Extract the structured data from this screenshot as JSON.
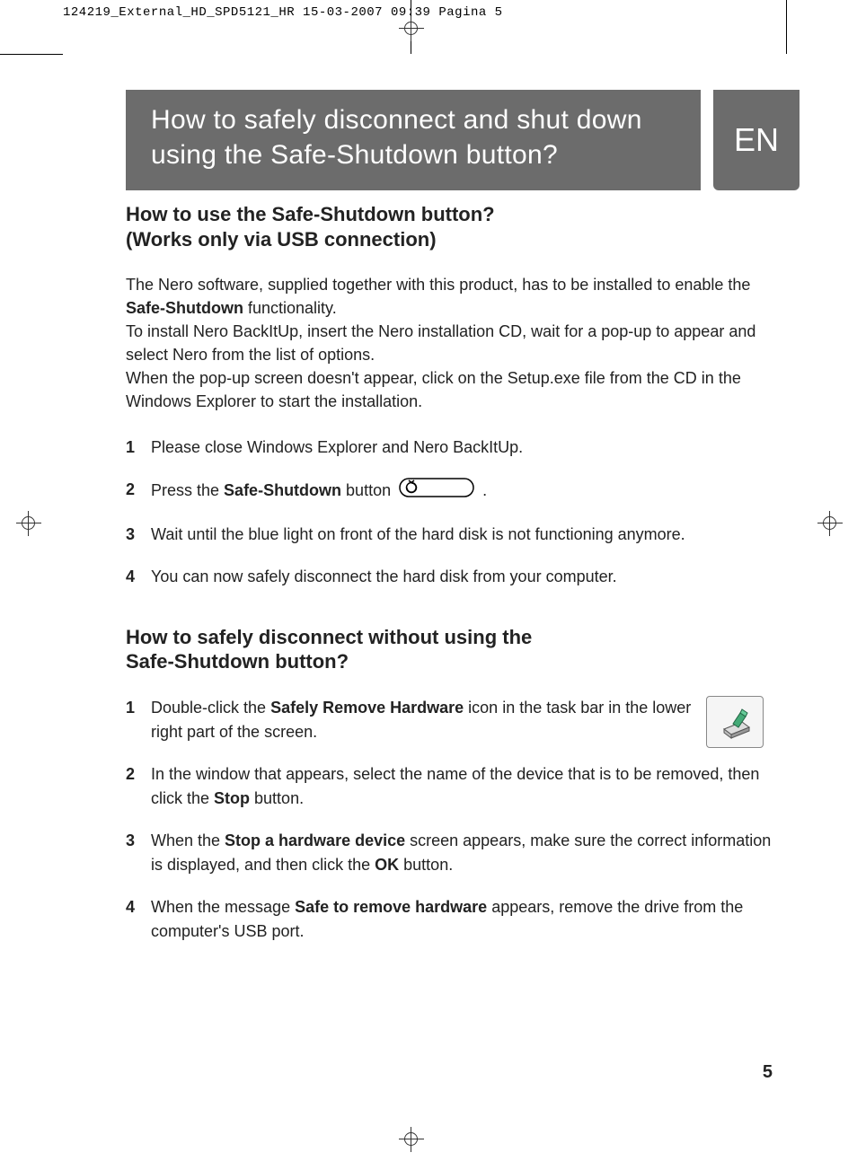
{
  "print_header": "124219_External_HD_SPD5121_HR  15-03-2007  09:39  Pagina 5",
  "title": {
    "line1": "How to safely disconnect and shut down",
    "line2": "using the Safe-Shutdown button?"
  },
  "lang_badge": "EN",
  "section1": {
    "heading_line1": "How to use the Safe-Shutdown button?",
    "heading_line2": "(Works only via USB connection)",
    "intro_part1": "The Nero software, supplied together with this product, has to be installed to enable the ",
    "intro_bold": "Safe-Shutdown",
    "intro_part2": " functionality.",
    "intro2": "To install Nero BackItUp, insert the Nero installation CD, wait for a pop-up to appear and select Nero from the list of options.",
    "intro3": "When the pop-up screen doesn't appear, click on the Setup.exe file from the CD in the Windows Explorer to start the installation.",
    "steps": {
      "s1_num": "1",
      "s1_text": "Please close Windows Explorer and Nero BackItUp.",
      "s2_num": "2",
      "s2_pre": "Press the ",
      "s2_bold": "Safe-Shutdown",
      "s2_mid": " button ",
      "s2_post": " .",
      "s3_num": "3",
      "s3_text": "Wait until the blue light on front of the hard disk is not functioning anymore.",
      "s4_num": "4",
      "s4_text": "You can now safely disconnect the hard disk from your computer."
    }
  },
  "section2": {
    "heading_line1": "How to safely disconnect without using the",
    "heading_line2": "Safe-Shutdown button?",
    "steps": {
      "s1_num": "1",
      "s1_pre": "Double-click the ",
      "s1_bold": "Safely Remove Hardware",
      "s1_post": " icon in the task bar in the lower right part of the screen.",
      "s2_num": "2",
      "s2_pre": "In the window that appears, select the name of the device that is to be removed, then click the ",
      "s2_bold": "Stop",
      "s2_post": " button.",
      "s3_num": "3",
      "s3_pre": "When the ",
      "s3_bold1": "Stop a hardware device",
      "s3_mid": " screen appears, make sure the correct information is displayed, and then click the ",
      "s3_bold2": "OK",
      "s3_post": " button.",
      "s4_num": "4",
      "s4_pre": "When the message ",
      "s4_bold": "Safe to remove hardware",
      "s4_post": " appears, remove the drive from the computer's USB port."
    }
  },
  "page_number": "5"
}
